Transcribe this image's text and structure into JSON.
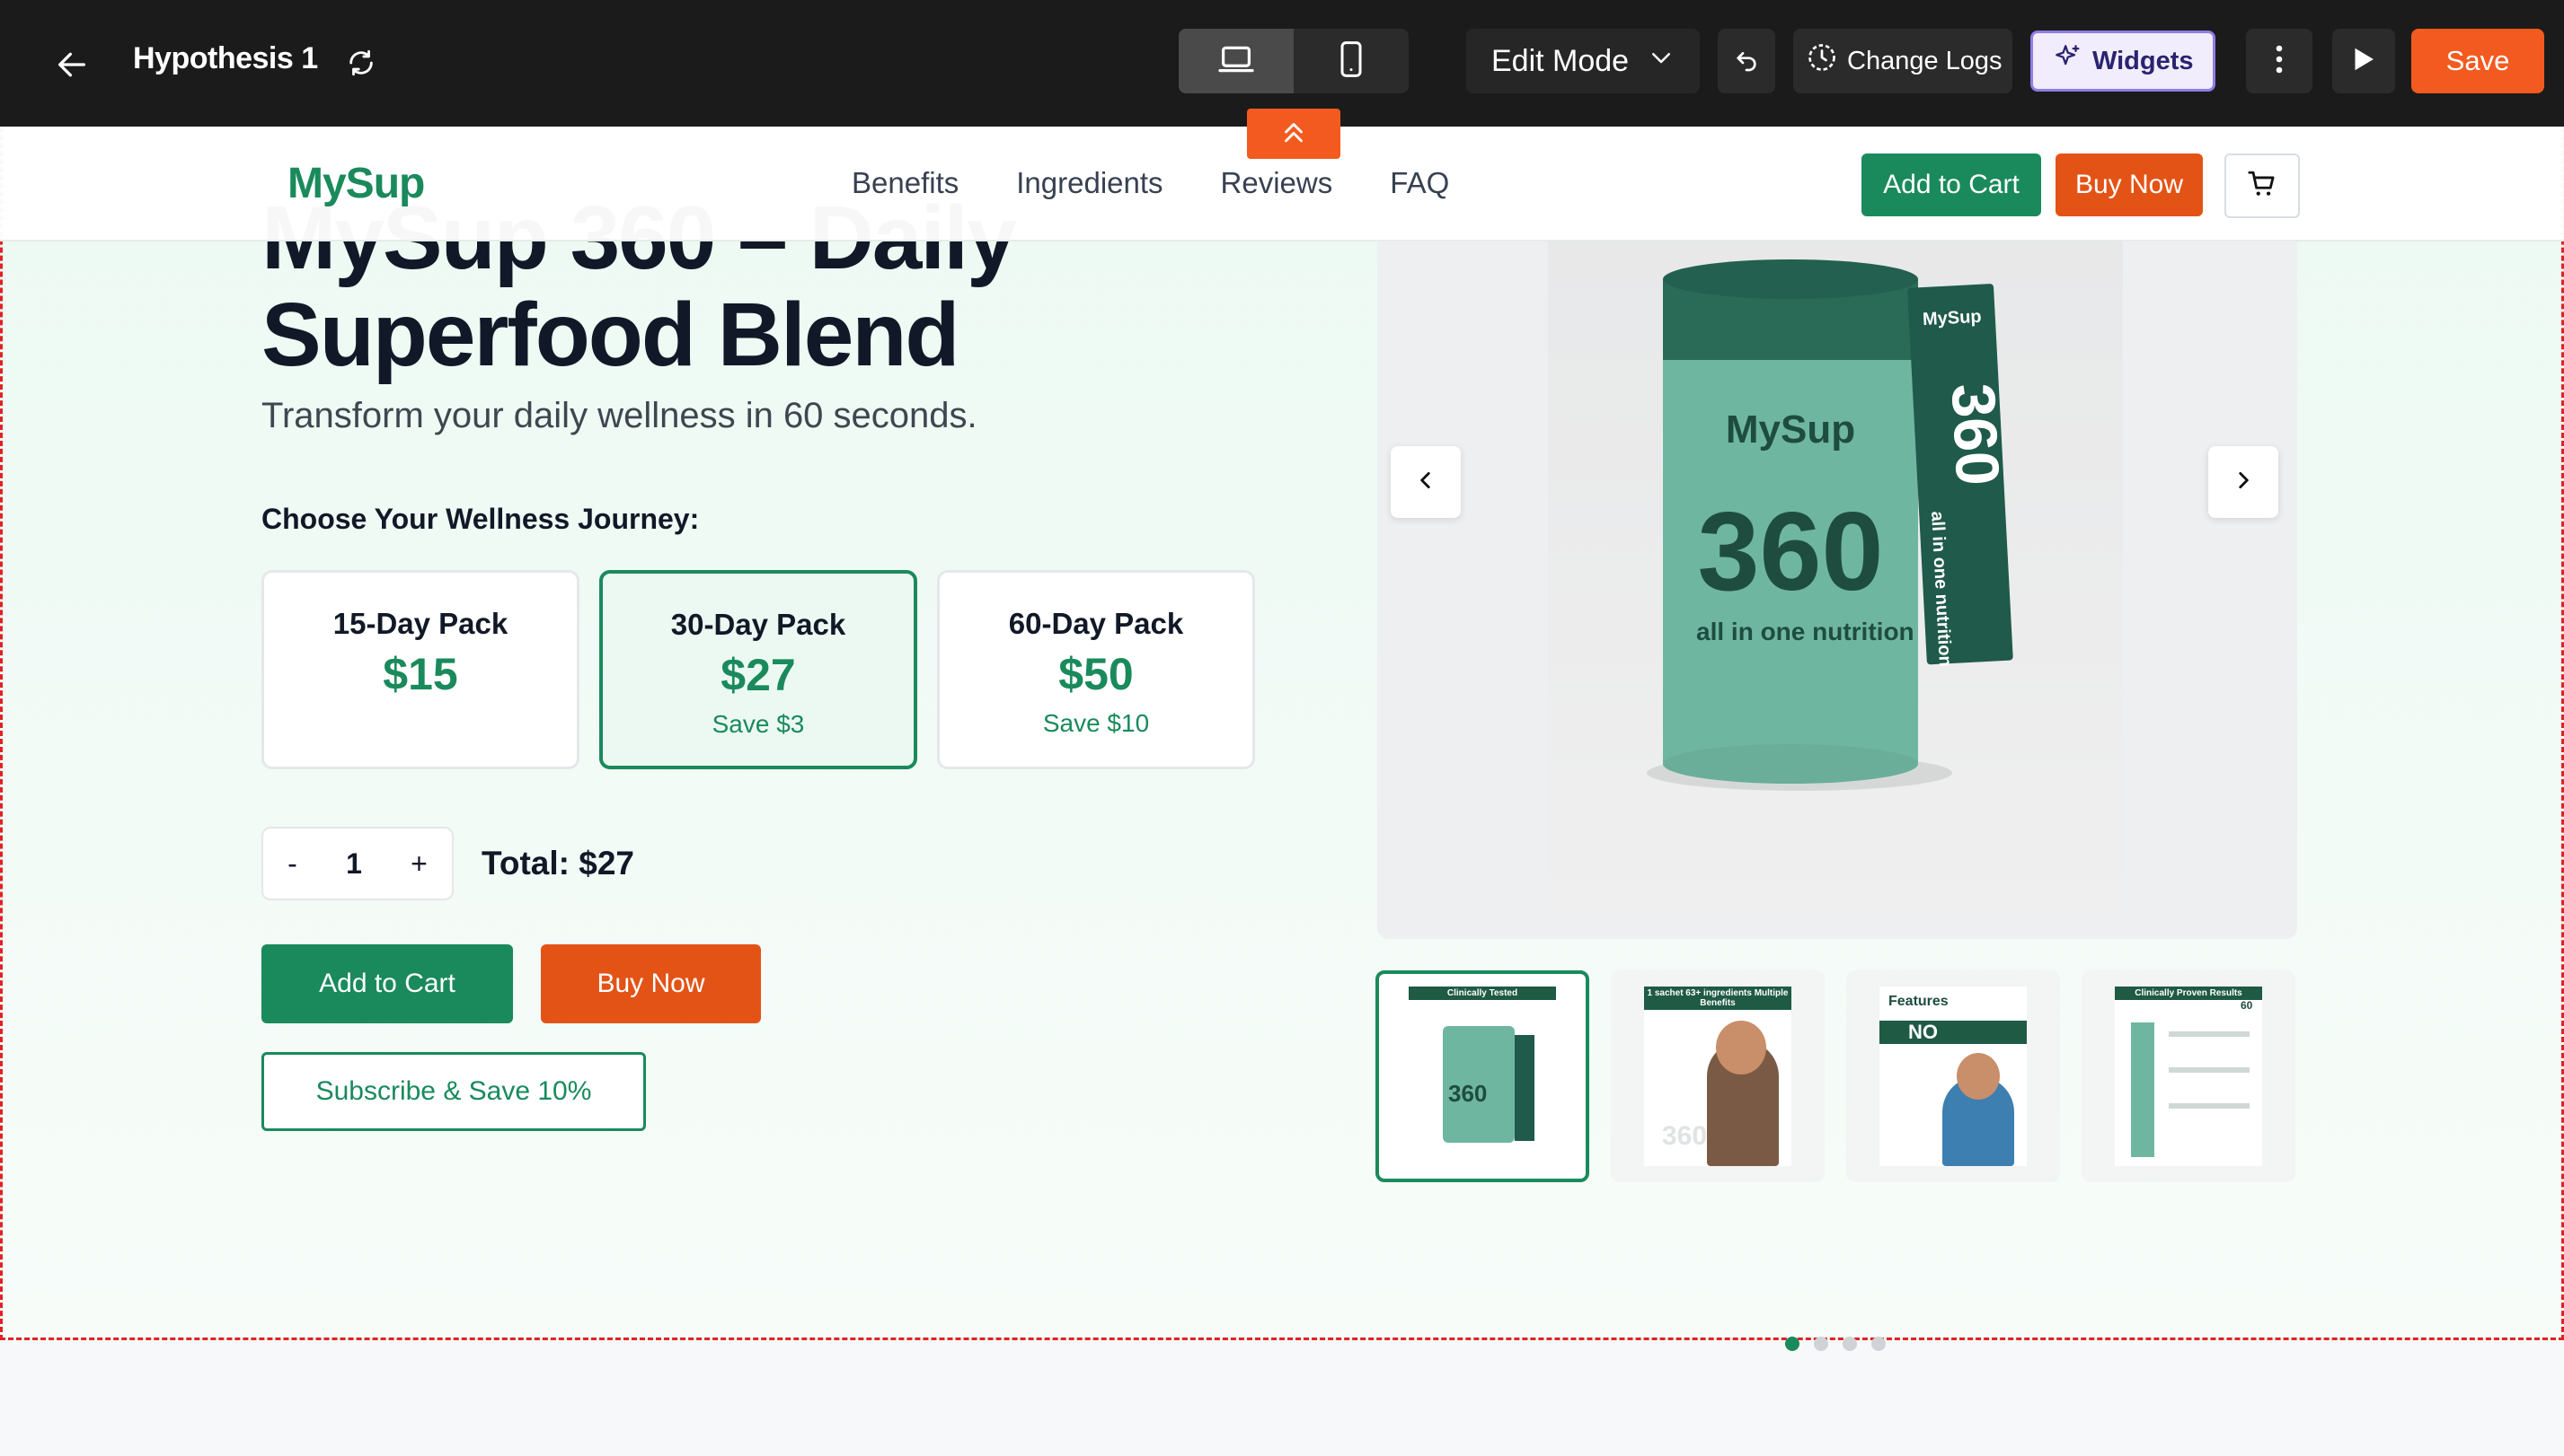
{
  "editor": {
    "title": "Hypothesis 1",
    "mode": "Edit Mode",
    "change_logs": "Change Logs",
    "widgets": "Widgets",
    "save": "Save"
  },
  "site": {
    "brand": "MySup",
    "nav": [
      "Benefits",
      "Ingredients",
      "Reviews",
      "FAQ"
    ],
    "header_add_to_cart": "Add to Cart",
    "header_buy_now": "Buy Now"
  },
  "hero": {
    "title": "MySup 360 – Daily Superfood Blend",
    "subtitle": "Transform your daily wellness in 60 seconds.",
    "choose_label": "Choose Your Wellness Journey:",
    "packs": [
      {
        "name": "15-Day Pack",
        "price": "$15",
        "save": ""
      },
      {
        "name": "30-Day Pack",
        "price": "$27",
        "save": "Save $3"
      },
      {
        "name": "60-Day Pack",
        "price": "$50",
        "save": "Save $10"
      }
    ],
    "quantity": {
      "minus": "-",
      "value": "1",
      "plus": "+"
    },
    "total": "Total: $27",
    "add_to_cart": "Add to Cart",
    "buy_now": "Buy Now",
    "subscribe": "Subscribe & Save 10%"
  },
  "product_image": {
    "can_brand": "MySup",
    "can_number": "360",
    "can_tagline": "all in one nutrition",
    "sachet_brand": "MySup",
    "sachet_number": "360",
    "sachet_tagline": "all in one nutrition"
  },
  "thumbnails": [
    {
      "caption": "Clinically Tested",
      "big": "360"
    },
    {
      "caption": "1 sachet 63+ ingredients Multiple Benefits",
      "big": "360"
    },
    {
      "caption": "Features",
      "big": "NO"
    },
    {
      "caption": "Clinically Proven Results",
      "big": "60"
    }
  ],
  "colors": {
    "brand_green": "#1a8a5c",
    "accent_orange": "#e35316",
    "editor_bar": "#1b1b1b",
    "save_orange": "#f35a1f"
  }
}
